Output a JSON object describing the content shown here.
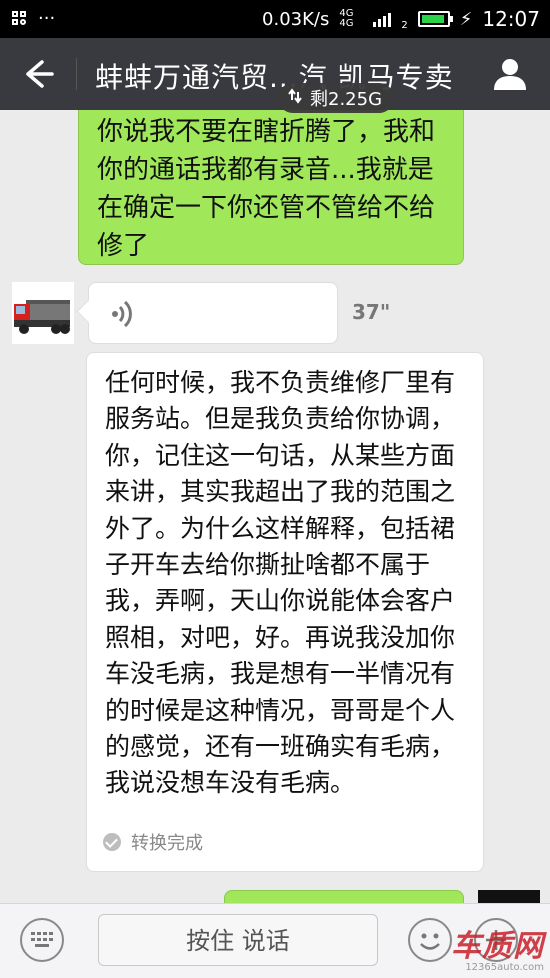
{
  "status_bar": {
    "notification_glyph": "···",
    "net_speed": "0.03K/s",
    "network_type": "4G 4G",
    "sim_label": "2",
    "time": "12:07",
    "battery_color": "#2cd34a",
    "icons": [
      "grid-icon",
      "signal-icon",
      "battery-icon",
      "charging-icon"
    ]
  },
  "header": {
    "title": "蚌蚌万通汽贸...汽 凯马专卖",
    "traffic_remaining": "剩2.25G",
    "icons": [
      "back-arrow-icon",
      "profile-icon",
      "sync-icon"
    ],
    "bg_color": "#393a3f"
  },
  "messages": {
    "outgoing_1": {
      "text": "你说我不要在瞎折腾了，我和你的通话我都有录音...我就是在确定一下你还管不管给不给修了"
    },
    "voice": {
      "duration": "37\"",
      "icon": "voice-wave-icon",
      "avatar": "truck-avatar"
    },
    "transcript": {
      "text": "任何时候，我不负责维修厂里有服务站。但是我负责给你协调，你，记住这一句话，从某些方面来讲，其实我超出了我的范围之外了。为什么这样解释，包括裙子开车去给你撕扯啥都不属于我，弄啊，天山你说能体会客户照相，对吧，好。再说我没加你车没毛病，我是想有一半情况有的时候是这种情况，哥哥是个人的感觉，还有一班确实有毛病，我说没想车没有毛病。",
      "status": "转换完成"
    },
    "bubble_color_out": "#a0e75a",
    "bubble_color_in": "#ffffff"
  },
  "input_bar": {
    "talk_label": "按住 说话",
    "icons": [
      "keyboard-icon",
      "emoji-icon",
      "plus-icon"
    ]
  },
  "watermark": {
    "logo": "车质网",
    "url": "12365auto.com"
  }
}
